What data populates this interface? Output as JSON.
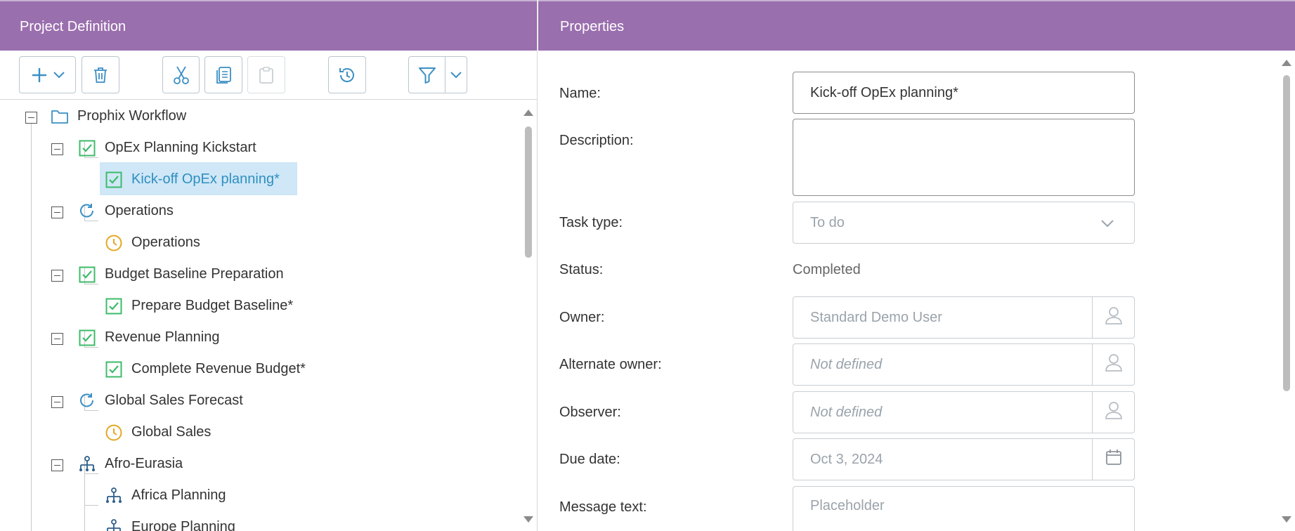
{
  "left_panel": {
    "title": "Project Definition"
  },
  "right_panel": {
    "title": "Properties"
  },
  "toolbar": {
    "add": "plus-icon",
    "delete": "trash-icon",
    "cut": "scissors-icon",
    "copy": "copy-icon",
    "paste": "paste-icon",
    "history": "history-icon",
    "filter": "filter-icon"
  },
  "tree": {
    "root": {
      "label": "Prophix Workflow",
      "icon": "folder-icon"
    },
    "items": [
      {
        "label": "OpEx Planning Kickstart",
        "icon": "check-icon"
      },
      {
        "label": "Kick-off OpEx planning*",
        "icon": "check-icon",
        "selected": true
      },
      {
        "label": "Operations",
        "icon": "refresh-icon"
      },
      {
        "label": "Operations",
        "icon": "clock-icon"
      },
      {
        "label": "Budget Baseline Preparation",
        "icon": "check-icon"
      },
      {
        "label": "Prepare Budget Baseline*",
        "icon": "check-icon"
      },
      {
        "label": "Revenue Planning",
        "icon": "check-icon"
      },
      {
        "label": "Complete Revenue Budget*",
        "icon": "check-icon"
      },
      {
        "label": "Global Sales Forecast",
        "icon": "refresh-icon"
      },
      {
        "label": "Global Sales",
        "icon": "clock-icon"
      },
      {
        "label": "Afro-Eurasia",
        "icon": "hierarchy-icon"
      },
      {
        "label": "Africa Planning",
        "icon": "hierarchy-icon"
      },
      {
        "label": "Europe Planning",
        "icon": "hierarchy-icon"
      }
    ]
  },
  "properties": {
    "name_label": "Name:",
    "name_value": "Kick-off OpEx planning*",
    "description_label": "Description:",
    "description_value": "",
    "task_type_label": "Task type:",
    "task_type_value": "To do",
    "status_label": "Status:",
    "status_value": "Completed",
    "owner_label": "Owner:",
    "owner_value": "Standard Demo User",
    "alt_owner_label": "Alternate owner:",
    "alt_owner_value": "Not defined",
    "observer_label": "Observer:",
    "observer_value": "Not defined",
    "due_date_label": "Due date:",
    "due_date_value": "Oct 3, 2024",
    "message_label": "Message text:",
    "message_placeholder": "Placeholder"
  },
  "colors": {
    "header": "#9a6fae",
    "check": "#3dbb6a",
    "refresh": "#3a8fc4",
    "clock": "#e5a823",
    "selected": "#cfe7f7"
  }
}
